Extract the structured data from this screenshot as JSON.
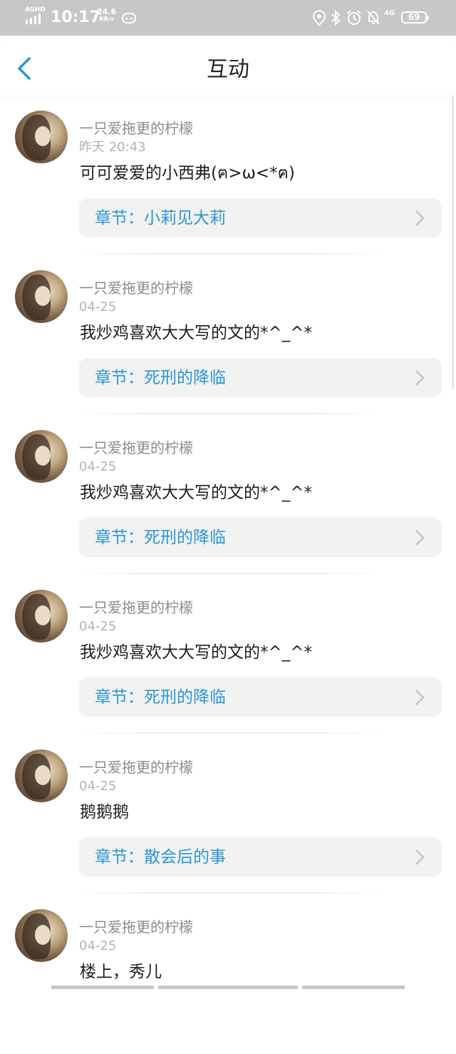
{
  "status_bar": {
    "network": "4GHD",
    "time": "10:17",
    "speed": "24.6",
    "speed_unit": "KB/s",
    "mobile": "4G",
    "battery": "69"
  },
  "header": {
    "title": "互动",
    "back_icon": "chevron-left-icon",
    "accent_color": "#2a96d6"
  },
  "items": [
    {
      "user": "一只爱拖更的柠檬",
      "time": "昨天 20:43",
      "content": "可可爱爱的小西弗(ฅ>ω<*ฅ)",
      "chapter": "章节：小莉见大莉"
    },
    {
      "user": "一只爱拖更的柠檬",
      "time": "04-25",
      "content": "我炒鸡喜欢大大写的文的*^_^*",
      "chapter": "章节：死刑的降临"
    },
    {
      "user": "一只爱拖更的柠檬",
      "time": "04-25",
      "content": "我炒鸡喜欢大大写的文的*^_^*",
      "chapter": "章节：死刑的降临"
    },
    {
      "user": "一只爱拖更的柠檬",
      "time": "04-25",
      "content": "我炒鸡喜欢大大写的文的*^_^*",
      "chapter": "章节：死刑的降临"
    },
    {
      "user": "一只爱拖更的柠檬",
      "time": "04-25",
      "content": "鹅鹅鹅",
      "chapter": "章节：散会后的事"
    },
    {
      "user": "一只爱拖更的柠檬",
      "time": "04-25",
      "content": "楼上，秀儿",
      "chapter": ""
    }
  ]
}
